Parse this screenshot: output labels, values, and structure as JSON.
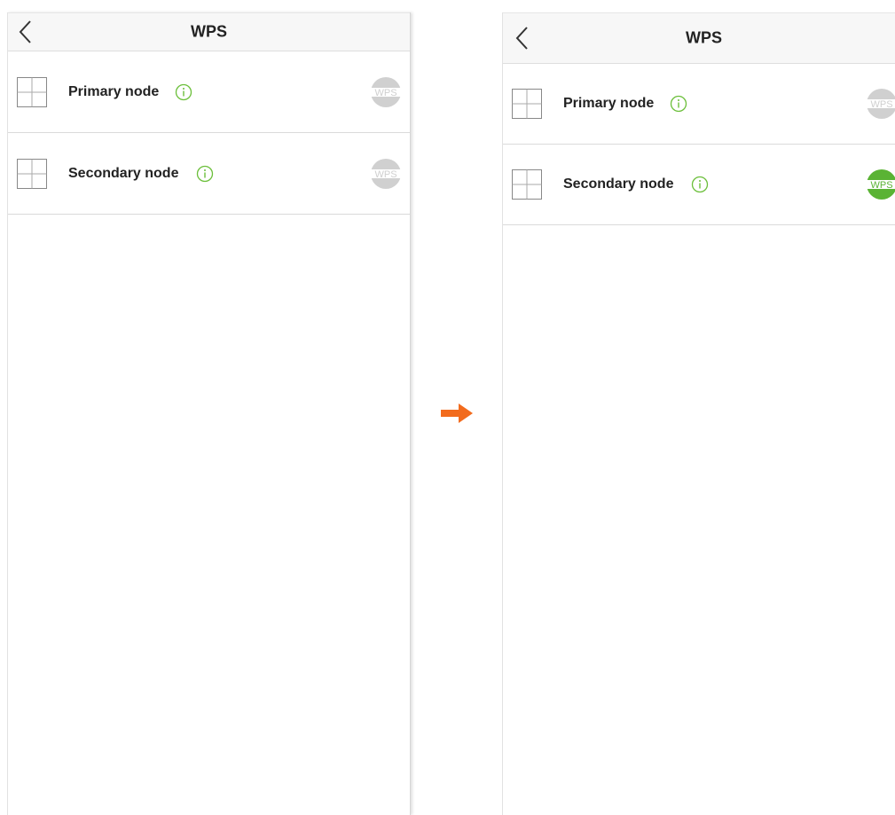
{
  "screens": [
    {
      "title": "WPS",
      "nodes": [
        {
          "label": "Primary node",
          "wps_label": "WPS",
          "wps_active": false
        },
        {
          "label": "Secondary node",
          "wps_label": "WPS",
          "wps_active": false
        }
      ]
    },
    {
      "title": "WPS",
      "nodes": [
        {
          "label": "Primary node",
          "wps_label": "WPS",
          "wps_active": false
        },
        {
          "label": "Secondary node",
          "wps_label": "WPS",
          "wps_active": true
        }
      ]
    }
  ],
  "icons": {
    "back": "chevron-left-icon",
    "node": "node-device-icon",
    "info": "info-icon",
    "wps": "wps-button-icon",
    "transition": "right-arrow-icon"
  },
  "colors": {
    "wps_inactive": "#d0d0d0",
    "wps_active": "#5ab334",
    "info_green": "#6bbf3a",
    "arrow_orange": "#f26b1d"
  }
}
